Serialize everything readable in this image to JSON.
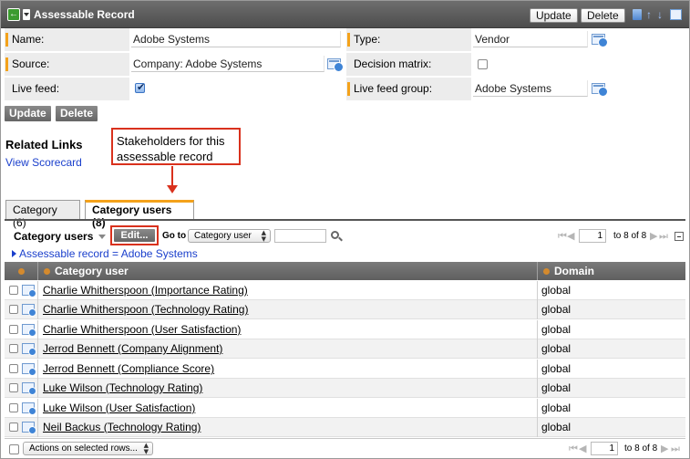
{
  "window": {
    "title": "Assessable Record",
    "update_label": "Update",
    "delete_label": "Delete"
  },
  "form": {
    "name_label": "Name:",
    "name_value": "Adobe Systems",
    "type_label": "Type:",
    "type_value": "Vendor",
    "source_label": "Source:",
    "source_value": "Company: Adobe Systems",
    "decision_matrix_label": "Decision matrix:",
    "decision_matrix_checked": false,
    "live_feed_label": "Live feed:",
    "live_feed_checked": true,
    "live_feed_group_label": "Live feed group:",
    "live_feed_group_value": "Adobe Systems",
    "update_label": "Update",
    "delete_label": "Delete"
  },
  "related": {
    "title": "Related Links",
    "link": "View Scorecard"
  },
  "callout": {
    "text": "Stakeholders for this assessable record",
    "border_color": "#d9311d"
  },
  "tabs": [
    {
      "label": "Category (6)",
      "active": false
    },
    {
      "label": "Category users (8)",
      "active": true
    }
  ],
  "list": {
    "label": "Category users",
    "edit_label": "Edit...",
    "goto_label": "Go to",
    "goto_select": "Category user",
    "page_value": "1",
    "range_text": "to 8 of 8",
    "filter": "Assessable record = Adobe Systems",
    "columns": [
      "Category user",
      "Domain"
    ],
    "rows": [
      {
        "user": "Charlie Whitherspoon (Importance Rating)",
        "domain": "global"
      },
      {
        "user": "Charlie Whitherspoon (Technology Rating)",
        "domain": "global"
      },
      {
        "user": "Charlie Whitherspoon (User Satisfaction)",
        "domain": "global"
      },
      {
        "user": "Jerrod Bennett (Company Alignment)",
        "domain": "global"
      },
      {
        "user": "Jerrod Bennett (Compliance Score)",
        "domain": "global"
      },
      {
        "user": "Luke Wilson (Technology Rating)",
        "domain": "global"
      },
      {
        "user": "Luke Wilson (User Satisfaction)",
        "domain": "global"
      },
      {
        "user": "Neil Backus (Technology Rating)",
        "domain": "global"
      }
    ],
    "actions_select": "Actions on selected rows...",
    "bottom_page_value": "1",
    "bottom_range_text": "to 8 of 8"
  },
  "colors": {
    "accent": "#f4a21b",
    "link": "#1a3fcc",
    "header": "#6e6e6e"
  }
}
